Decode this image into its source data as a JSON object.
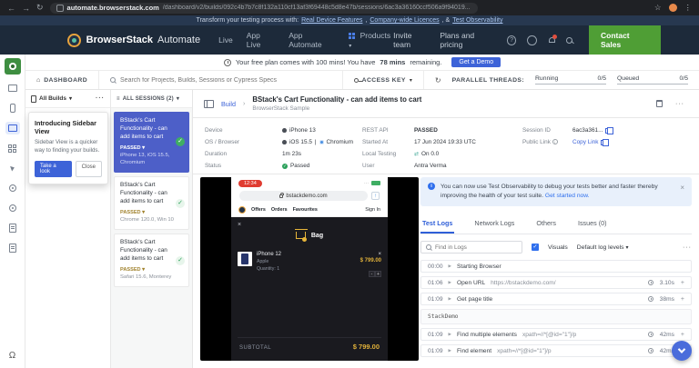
{
  "colors": {
    "accent_blue": "#3d63d8",
    "header_dark": "#1d2a3a",
    "contact_green": "#4f9e35",
    "selected_session": "#4d5fc8",
    "passed_green": "#2aa05a",
    "banner_blue_bg": "#e8f0fb",
    "price_yellow": "#e0b13a"
  },
  "chrome": {
    "domain": "automate.browserstack.com",
    "path": "/dashboard/v2/builds/092c4b7b7c8f132a110cf13af3f69448c5d8e47b/sessions/6ac3a36160ccf506a9f94019..."
  },
  "promo": {
    "prefix": "Transform your testing process with:",
    "link_device": "Real Device Features",
    "comma": ",",
    "link_licences": "Company-wide Licences",
    "amp": ", &",
    "link_observability": "Test Observability"
  },
  "header": {
    "brand": "BrowserStack",
    "product": "Automate",
    "nav_live": "Live",
    "nav_app_live": "App Live",
    "nav_app_automate": "App Automate",
    "products": "Products",
    "invite": "Invite team",
    "plans": "Plans and pricing",
    "contact_sales": "Contact Sales"
  },
  "plan": {
    "pre": "Your free plan comes with 100 mins! You have",
    "highlight": "78 mins",
    "post": "remaining.",
    "cta": "Get a Demo"
  },
  "toolbar": {
    "dashboard": "DASHBOARD",
    "search_placeholder": "Search for Projects, Builds, Sessions or Cypress Specs",
    "access_key": "ACCESS KEY",
    "parallel_label": "PARALLEL THREADS:",
    "running_label": "Running",
    "running_value": "0/5",
    "queued_label": "Queued",
    "queued_value": "0/5"
  },
  "builds": {
    "title": "All Builds",
    "popover_title": "Introducing Sidebar View",
    "popover_body": "Sidebar View is a quicker way to finding your builds.",
    "take_a_look": "Take a look",
    "close": "Close"
  },
  "sessions": {
    "header": "ALL SESSIONS (2)",
    "items": [
      {
        "title": "BStack's Cart Functionality - can add items to cart",
        "status": "PASSED",
        "env": "iPhone 13, iOS 15.5, Chromium"
      },
      {
        "title": "BStack's Cart Functionality - can add items to cart",
        "status": "PASSED",
        "env": "Chrome 120.0, Win 10"
      },
      {
        "title": "BStack's Cart Functionality - can add items to cart",
        "status": "PASSED",
        "env": "Safari 15.6, Monterey"
      }
    ]
  },
  "session": {
    "breadcrumb": "Build",
    "title": "BStack's Cart Functionality - can add items to cart",
    "project": "BrowserStack Sample",
    "meta": {
      "device_label": "Device",
      "device": "iPhone 13",
      "os_label": "OS / Browser",
      "os_1": "iOS 15.5",
      "pipe": "|",
      "os_2": "Chromium",
      "duration_label": "Duration",
      "duration": "1m 23s",
      "status_label": "Status",
      "status": "Passed",
      "rest_label": "REST API",
      "rest": "PASSED",
      "started_label": "Started At",
      "started": "17 Jun 2024 19:33 UTC",
      "local_label": "Local Testing",
      "local": "On 0.0",
      "user_label": "User",
      "user": "Antra Verma",
      "session_id_label": "Session ID",
      "session_id": "6ac3a361...",
      "public_link_label": "Public Link",
      "copy_link": "Copy Link"
    }
  },
  "player": {
    "time": "12:34",
    "url": "bstackdemo.com",
    "nav_offers": "Offers",
    "nav_orders": "Orders",
    "nav_favourites": "Favourites",
    "sign_in": "Sign In",
    "bag": "Bag",
    "item_name": "iPhone 12",
    "item_brand": "Apple",
    "item_qty": "Quantity: 1",
    "item_price": "$ 799.00",
    "subtotal_label": "SUBTOTAL",
    "subtotal": "$ 799.00"
  },
  "observability": {
    "text": "You can now use Test Observability to debug your tests better and faster thereby improving the health of your test suite.",
    "link": "Get started now."
  },
  "tabs": {
    "test_logs": "Test Logs",
    "network_logs": "Network Logs",
    "others": "Others",
    "issues": "Issues (0)"
  },
  "logs": {
    "find_placeholder": "Find in Logs",
    "visuals": "Visuals",
    "levels": "Default log levels",
    "output": "StackDemo",
    "rows": [
      {
        "time": "00:00",
        "action": "Starting Browser",
        "detail": "",
        "duration": ""
      },
      {
        "time": "01:06",
        "action": "Open URL",
        "detail": "https://bstackdemo.com/",
        "duration": "3.10s"
      },
      {
        "time": "01:09",
        "action": "Get page title",
        "detail": "",
        "duration": "38ms"
      },
      {
        "time": "01:09",
        "action": "Find multiple elements",
        "detail": "xpath=//*[@id=\"1\"]/p",
        "duration": "42ms"
      },
      {
        "time": "01:09",
        "action": "Find element",
        "detail": "xpath=//*[@id=\"1\"]/p",
        "duration": "42ms"
      }
    ]
  },
  "glyphs": {
    "back": "←",
    "forward": "→",
    "refresh": "↻",
    "star": "☆",
    "more_v": "⋮",
    "chevron": "▾",
    "crumb_sep": "›",
    "more": "···",
    "hamburger": "≡",
    "home": "⌂",
    "question": "?",
    "info": "i",
    "check": "✓",
    "close": "×",
    "plus": "+",
    "share": "↑",
    "toggle": "⇄",
    "headset": "Ω",
    "dots": "···"
  }
}
